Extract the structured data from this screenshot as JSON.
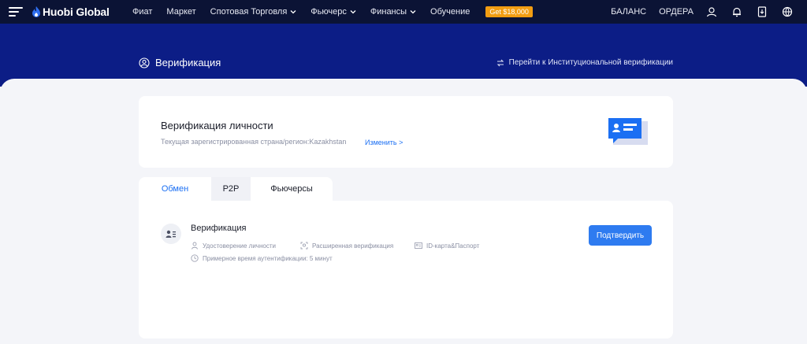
{
  "nav": {
    "brand": "Huobi Global",
    "links": [
      {
        "label": "Фиат",
        "dropdown": false
      },
      {
        "label": "Маркет",
        "dropdown": false
      },
      {
        "label": "Спотовая Торговля",
        "dropdown": true
      },
      {
        "label": "Фьючерс",
        "dropdown": true
      },
      {
        "label": "Финансы",
        "dropdown": true
      },
      {
        "label": "Обучение",
        "dropdown": false
      }
    ],
    "gift_badge": "Get $18,000",
    "right_links": [
      "БАЛАНС",
      "ОРДЕРА"
    ],
    "right_icons": [
      "user-icon",
      "bell-icon",
      "download-icon",
      "globe-icon"
    ]
  },
  "header": {
    "title": "Верификация",
    "institutional_link": "Перейти к Институциональной верификации"
  },
  "identity_card": {
    "title": "Верификация личности",
    "country_text": "Текущая зарегистрированная страна/регион:Kazakhstan",
    "change_link": "Изменить >"
  },
  "tabs": [
    {
      "label": "Обмен",
      "active": true
    },
    {
      "label": "P2P",
      "active": false
    },
    {
      "label": "Фьючерсы",
      "active": false
    }
  ],
  "verification": {
    "title": "Верификация",
    "features": [
      "Удостоверение личности",
      "Расширенная верификация",
      "ID-карта&Паспорт",
      "Примерное время аутентификации: 5 минут"
    ],
    "confirm_button": "Подтвердить"
  },
  "colors": {
    "nav_bg": "#0b1335",
    "banner_bg": "#0c1d86",
    "accent": "#2e7bf0",
    "gift_badge": "#f29d12"
  }
}
